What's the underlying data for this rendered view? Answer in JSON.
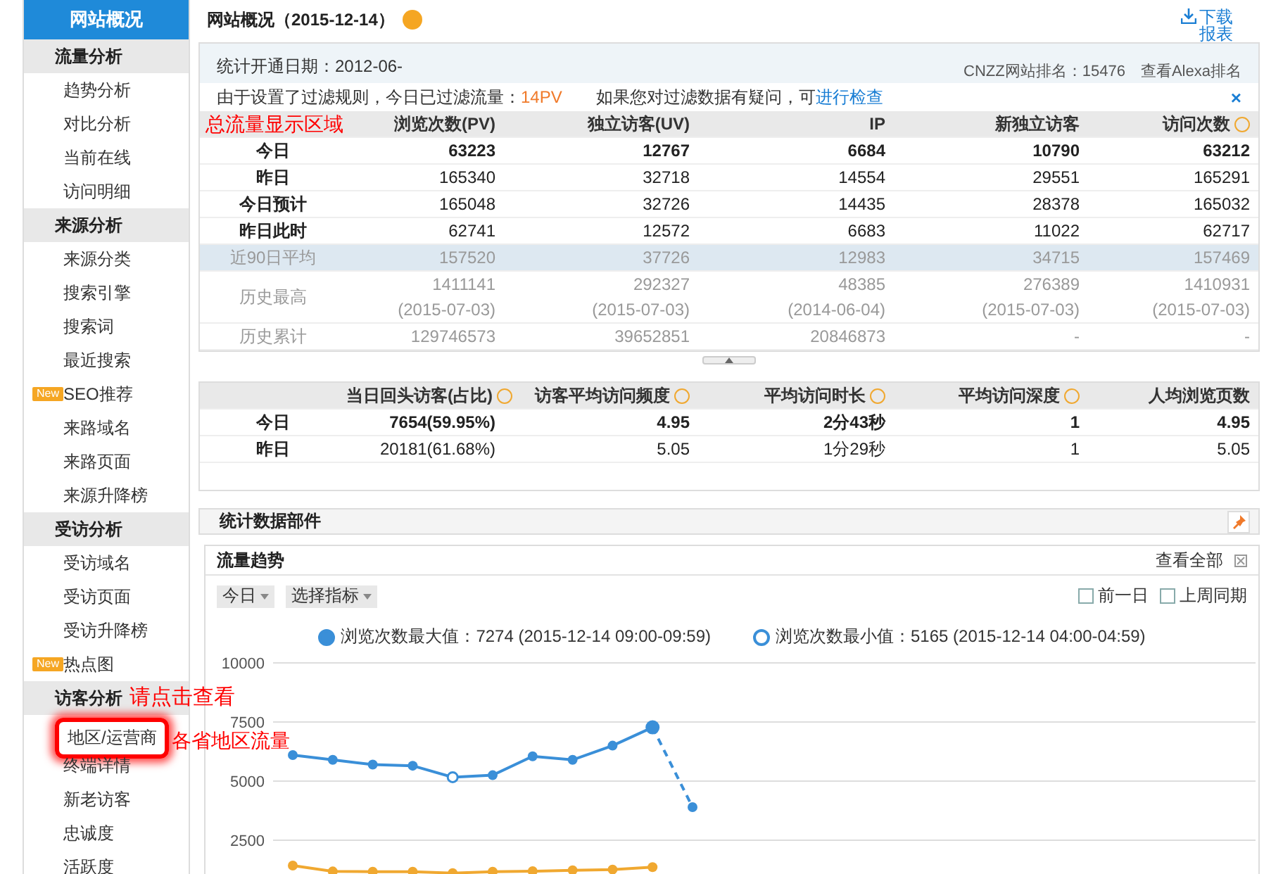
{
  "sidebar": {
    "top": {
      "label": "网站概况",
      "selected": true
    },
    "sections": [
      {
        "title": "流量分析",
        "items": [
          {
            "label": "趋势分析",
            "highlighted": false
          },
          {
            "label": "对比分析",
            "highlighted": false
          },
          {
            "label": "当前在线",
            "highlighted": false
          },
          {
            "label": "访问明细",
            "highlighted": false
          }
        ]
      },
      {
        "title": "来源分析",
        "items": [
          {
            "label": "来源分类",
            "highlighted": false
          },
          {
            "label": "搜索引擎",
            "highlighted": false
          },
          {
            "label": "搜索词",
            "highlighted": false
          },
          {
            "label": "最近搜索",
            "highlighted": false
          },
          {
            "label": "SEO推荐",
            "badge": "New",
            "highlighted": false
          },
          {
            "label": "来路域名",
            "highlighted": false
          },
          {
            "label": "来路页面",
            "highlighted": false
          },
          {
            "label": "来源升降榜",
            "highlighted": false
          }
        ]
      },
      {
        "title": "受访分析",
        "items": [
          {
            "label": "受访域名",
            "highlighted": false
          },
          {
            "label": "受访页面",
            "highlighted": false
          },
          {
            "label": "受访升降榜",
            "highlighted": false
          },
          {
            "label": "热点图",
            "badge": "New",
            "highlighted": false
          }
        ]
      },
      {
        "title": "访客分析",
        "hint": "请点击查看",
        "items": [
          {
            "label": "地区/运营商",
            "highlighted": true,
            "hint": "各省地区流量"
          },
          {
            "label": "终端详情",
            "highlighted": false
          },
          {
            "label": "新老访客",
            "highlighted": false
          },
          {
            "label": "忠诚度",
            "highlighted": false
          },
          {
            "label": "活跃度",
            "highlighted": false
          }
        ]
      }
    ]
  },
  "header": {
    "title": "网站概况（2015-12-14）",
    "download": "下载报表"
  },
  "info": {
    "start_date": "统计开通日期：2012-06-",
    "rank": "CNZZ网站排名：15476",
    "alexa": "查看Alexa排名"
  },
  "filter_notice": {
    "text": "由于设置了过滤规则，今日已过滤流量：",
    "count": "14PV",
    "question": "如果您对过滤数据有疑问，可",
    "link": "进行检查",
    "close": "×"
  },
  "overview_table": {
    "corner_label": "总流量显示区域",
    "columns": [
      {
        "label": "浏览次数(PV)",
        "help": false
      },
      {
        "label": "独立访客(UV)",
        "help": false
      },
      {
        "label": "IP",
        "help": false
      },
      {
        "label": "新独立访客",
        "help": false
      },
      {
        "label": "访问次数",
        "help": true
      }
    ],
    "rows": [
      {
        "label": "今日",
        "kind": "today",
        "cells": [
          {
            "value": "63223"
          },
          {
            "value": "12767"
          },
          {
            "value": "6684"
          },
          {
            "value": "10790"
          },
          {
            "value": "63212"
          }
        ]
      },
      {
        "label": "昨日",
        "kind": "normal",
        "cells": [
          {
            "value": "165340"
          },
          {
            "value": "32718"
          },
          {
            "value": "14554"
          },
          {
            "value": "29551"
          },
          {
            "value": "165291"
          }
        ]
      },
      {
        "label": "今日预计",
        "kind": "normal",
        "cells": [
          {
            "value": "165048"
          },
          {
            "value": "32726"
          },
          {
            "value": "14435"
          },
          {
            "value": "28378"
          },
          {
            "value": "165032"
          }
        ]
      },
      {
        "label": "昨日此时",
        "kind": "normal",
        "cells": [
          {
            "value": "62741"
          },
          {
            "value": "12572"
          },
          {
            "value": "6683"
          },
          {
            "value": "11022"
          },
          {
            "value": "62717"
          }
        ]
      },
      {
        "label": "近90日平均",
        "kind": "average",
        "cells": [
          {
            "value": "157520"
          },
          {
            "value": "37726"
          },
          {
            "value": "12983"
          },
          {
            "value": "34715"
          },
          {
            "value": "157469"
          }
        ]
      },
      {
        "label": "历史最高",
        "kind": "history",
        "cells": [
          {
            "value": "1411141",
            "date": "(2015-07-03)"
          },
          {
            "value": "292327",
            "date": "(2015-07-03)"
          },
          {
            "value": "48385",
            "date": "(2014-06-04)"
          },
          {
            "value": "276389",
            "date": "(2015-07-03)"
          },
          {
            "value": "1410931",
            "date": "(2015-07-03)"
          }
        ]
      },
      {
        "label": "历史累计",
        "kind": "history",
        "cells": [
          {
            "value": "129746573"
          },
          {
            "value": "39652851"
          },
          {
            "value": "20846873"
          },
          {
            "value": "-"
          },
          {
            "value": "-"
          }
        ]
      }
    ]
  },
  "visit_table": {
    "columns": [
      {
        "label": "当日回头访客(占比)",
        "help": true
      },
      {
        "label": "访客平均访问频度",
        "help": true
      },
      {
        "label": "平均访问时长",
        "help": true
      },
      {
        "label": "平均访问深度",
        "help": true
      },
      {
        "label": "人均浏览页数",
        "help": false
      }
    ],
    "rows": [
      {
        "label": "今日",
        "kind": "today",
        "cells": [
          {
            "value": "7654(59.95%)"
          },
          {
            "value": "4.95"
          },
          {
            "value": "2分43秒"
          },
          {
            "value": "1"
          },
          {
            "value": "4.95"
          }
        ]
      },
      {
        "label": "昨日",
        "kind": "normal",
        "cells": [
          {
            "value": "20181(61.68%)"
          },
          {
            "value": "5.05"
          },
          {
            "value": "1分29秒"
          },
          {
            "value": "1"
          },
          {
            "value": "5.05"
          }
        ]
      }
    ]
  },
  "widgets_panel": {
    "title": "统计数据部件"
  },
  "trend_panel": {
    "title": "流量趋势",
    "view_all": "查看全部",
    "dropdowns": [
      "今日",
      "选择指标"
    ],
    "compare": [
      {
        "label": "前一日",
        "checked": false
      },
      {
        "label": "上周同期",
        "checked": false
      }
    ],
    "legend": [
      {
        "kind": "max",
        "text": "浏览次数最大值：7274 (2015-12-14 09:00-09:59)"
      },
      {
        "kind": "min",
        "text": "浏览次数最小值：5165 (2015-12-14 04:00-04:59)"
      }
    ],
    "y_axis_labels": [
      "10000",
      "7500",
      "5000",
      "2500"
    ]
  }
}
